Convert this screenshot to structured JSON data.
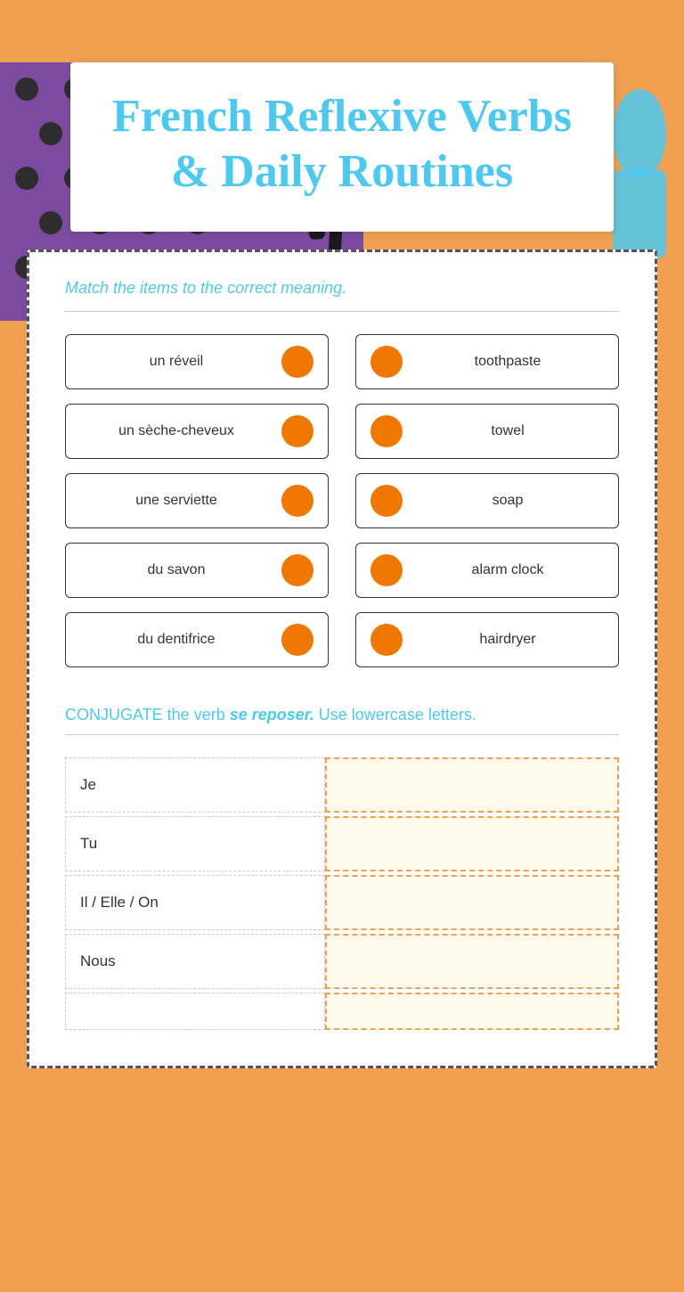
{
  "title": "French Reflexive Verbs & Daily Routines",
  "match_heading": "Match the items to the correct meaning.",
  "left_items": [
    "un réveil",
    "un sèche-cheveux",
    "une serviette",
    "du savon",
    "du dentifrice"
  ],
  "right_items": [
    "toothpaste",
    "towel",
    "soap",
    "alarm clock",
    "hairdryer"
  ],
  "conjugate_label_normal": "CONJUGATE the verb ",
  "conjugate_verb": "se reposer.",
  "conjugate_suffix": "  Use lowercase letters.",
  "pronouns": [
    "Je",
    "Tu",
    "Il / Elle / On",
    "Nous"
  ]
}
